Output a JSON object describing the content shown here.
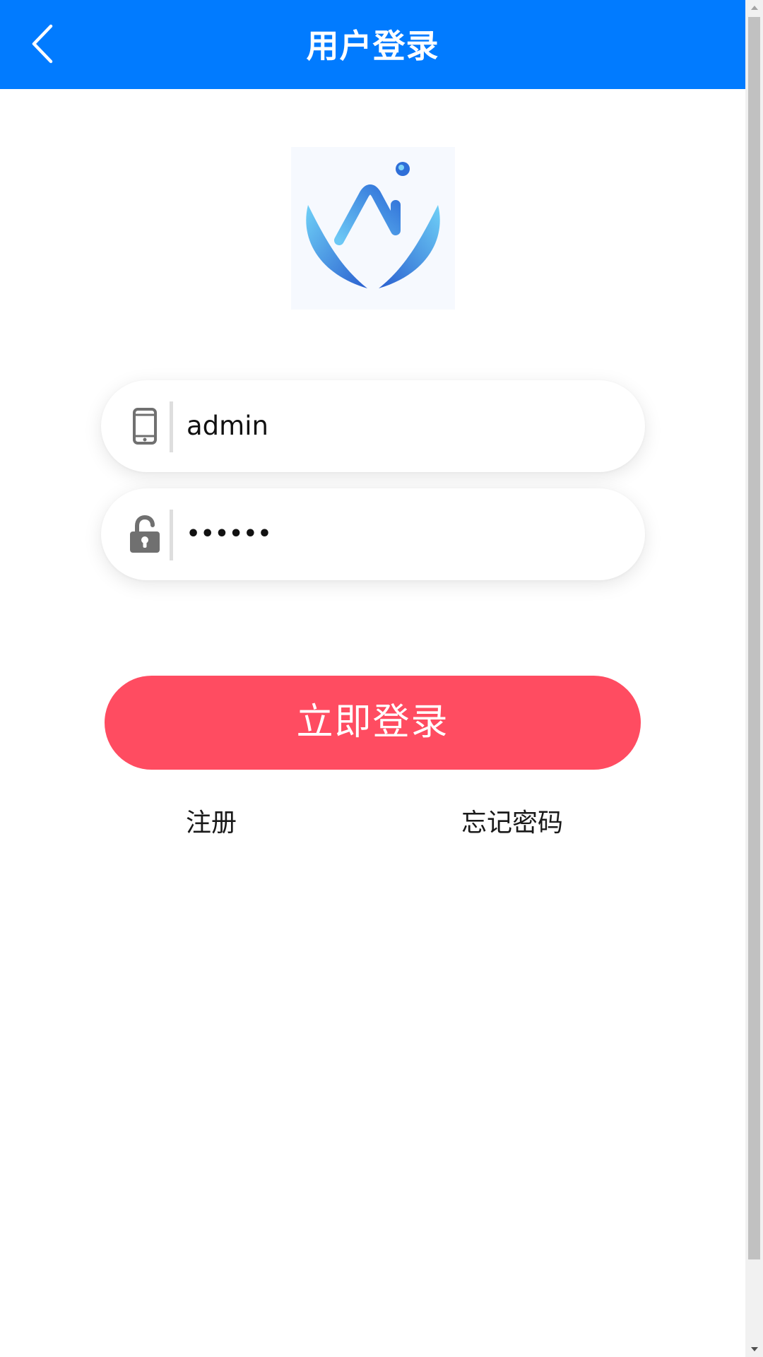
{
  "header": {
    "title": "用户登录",
    "back_icon": "chevron-left-icon",
    "background": "#017bff"
  },
  "logo": {
    "name": "ai-logo",
    "colors": [
      "#2f6fd8",
      "#5fc4f4"
    ]
  },
  "form": {
    "username": {
      "icon": "phone-icon",
      "value": "admin"
    },
    "password": {
      "icon": "unlock-icon",
      "value": "••••••"
    },
    "login_label": "立即登录",
    "login_color": "#ff4c61"
  },
  "links": {
    "register": "注册",
    "forgot_password": "忘记密码"
  }
}
